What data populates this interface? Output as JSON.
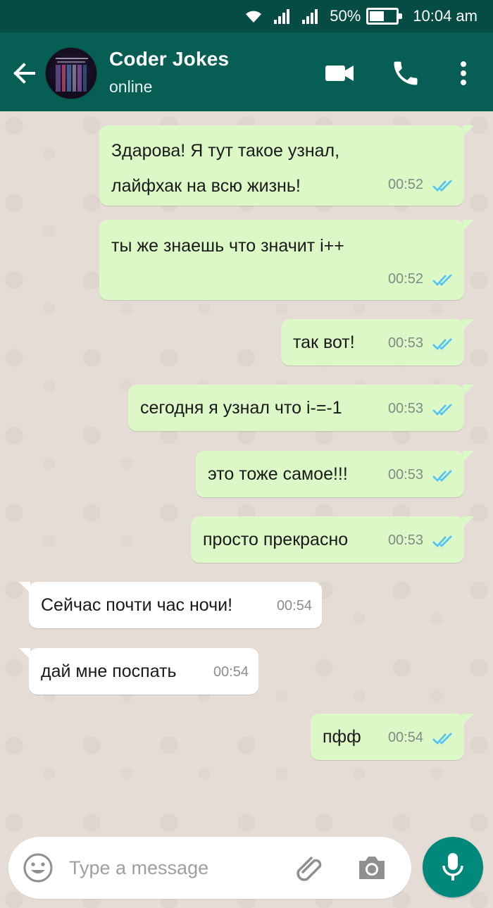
{
  "status_bar": {
    "battery_percent": "50%",
    "battery_level": 0.5,
    "time": "10:04 am",
    "icons": [
      "wifi-icon",
      "signal-icon",
      "signal-icon",
      "battery-icon"
    ]
  },
  "header": {
    "contact_name": "Coder Jokes",
    "contact_status": "online",
    "icons": [
      "back-arrow-icon",
      "video-call-icon",
      "phone-icon",
      "more-vert-icon"
    ]
  },
  "messages": [
    {
      "direction": "out",
      "lines": [
        "Здарова! Я тут такое узнал,",
        "лайфхак на всю жизнь!"
      ],
      "time": "00:52",
      "read": true
    },
    {
      "direction": "out",
      "lines": [
        "ты же знаешь что значит i++"
      ],
      "time": "00:52",
      "read": true
    },
    {
      "direction": "out",
      "lines": [
        "так вот!"
      ],
      "time": "00:53",
      "read": true
    },
    {
      "direction": "out",
      "lines": [
        "сегодня я узнал что i-=-1"
      ],
      "time": "00:53",
      "read": true
    },
    {
      "direction": "out",
      "lines": [
        "это тоже самое!!!"
      ],
      "time": "00:53",
      "read": true
    },
    {
      "direction": "out",
      "lines": [
        "просто прекрасно"
      ],
      "time": "00:53",
      "read": true
    },
    {
      "direction": "in",
      "lines": [
        "Сейчас почти час ночи!"
      ],
      "time": "00:54"
    },
    {
      "direction": "in",
      "lines": [
        "дай мне поспать"
      ],
      "time": "00:54"
    },
    {
      "direction": "out",
      "lines": [
        "пфф"
      ],
      "time": "00:54",
      "read": true
    }
  ],
  "input": {
    "placeholder": "Type a message",
    "icons": [
      "emoji-icon",
      "attach-icon",
      "camera-icon",
      "mic-icon"
    ]
  },
  "colors": {
    "status_bar": "#054d44",
    "header": "#075e54",
    "chat_bg": "#e5ddd5",
    "outgoing_bubble": "#dcf8c6",
    "incoming_bubble": "#ffffff",
    "read_ticks": "#4fc3f7",
    "mic_button": "#00897b"
  }
}
